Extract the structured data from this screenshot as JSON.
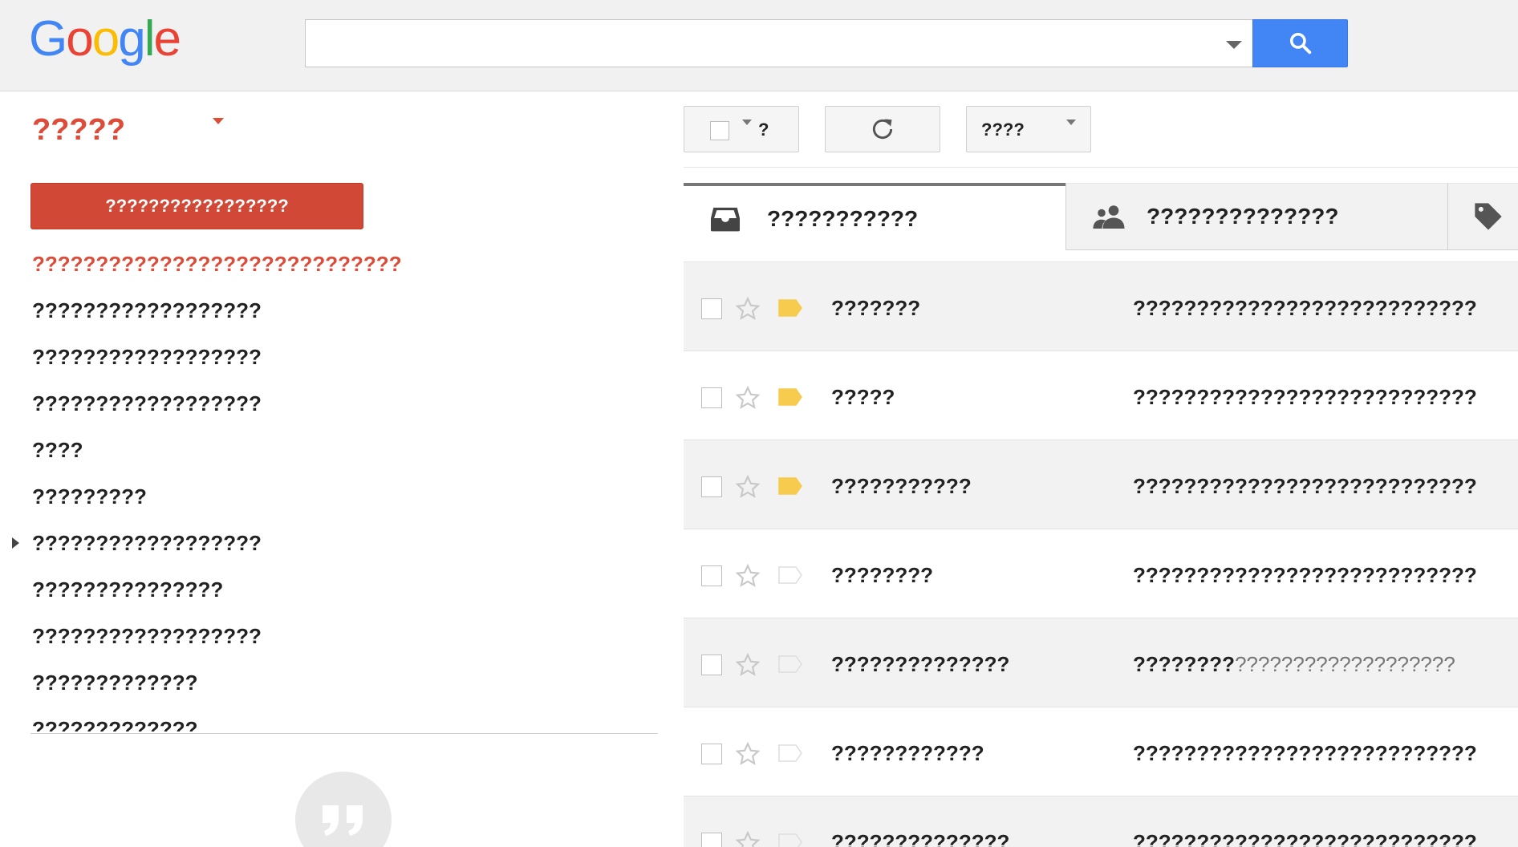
{
  "header": {
    "logo_letters": [
      {
        "char": "G",
        "color": "#4285f4"
      },
      {
        "char": "o",
        "color": "#ea4335"
      },
      {
        "char": "o",
        "color": "#fbbc05"
      },
      {
        "char": "g",
        "color": "#4285f4"
      },
      {
        "char": "l",
        "color": "#34a853"
      },
      {
        "char": "e",
        "color": "#ea4335"
      }
    ],
    "search_value": "",
    "search_icon": "search-icon",
    "search_button_color": "#4285f4"
  },
  "sidebar": {
    "app_title": "?????",
    "compose_label": "?????????????????",
    "compose_color": "#d14836",
    "accent_color": "#dd4b39",
    "items": [
      {
        "label": "?????????????????????????????",
        "active": true,
        "expandable": false
      },
      {
        "label": "??????????????????",
        "active": false,
        "expandable": false
      },
      {
        "label": "??????????????????",
        "active": false,
        "expandable": false
      },
      {
        "label": "??????????????????",
        "active": false,
        "expandable": false
      },
      {
        "label": "????",
        "active": false,
        "expandable": false
      },
      {
        "label": "?????????",
        "active": false,
        "expandable": false
      },
      {
        "label": "??????????????????",
        "active": false,
        "expandable": true
      },
      {
        "label": "???????????????",
        "active": false,
        "expandable": false
      },
      {
        "label": "??????????????????",
        "active": false,
        "expandable": false
      },
      {
        "label": "?????????????",
        "active": false,
        "expandable": false
      },
      {
        "label": "?????????????",
        "active": false,
        "expandable": false
      }
    ],
    "hangouts_icon": "quote-icon"
  },
  "toolbar": {
    "select_label": "?",
    "refresh_icon": "refresh-icon",
    "more_label": "????"
  },
  "tabs": [
    {
      "label": "???????????",
      "icon": "inbox-icon",
      "active": true
    },
    {
      "label": "??????????????",
      "icon": "people-icon",
      "active": false
    },
    {
      "label": "",
      "icon": "tag-icon",
      "active": false
    }
  ],
  "emails": [
    {
      "sender": "???????",
      "subject": "???????????????????????????",
      "snippet": "",
      "important": true,
      "unread": false
    },
    {
      "sender": "?????",
      "subject": "???????????????????????????",
      "snippet": "",
      "important": true,
      "unread": true
    },
    {
      "sender": "???????????",
      "subject": "???????????????????????????",
      "snippet": "",
      "important": true,
      "unread": false
    },
    {
      "sender": "????????",
      "subject": "???????????????????????????",
      "snippet": "",
      "important": false,
      "unread": true
    },
    {
      "sender": "??????????????",
      "subject": "????????",
      "snippet": "???????????????????",
      "important": false,
      "unread": false
    },
    {
      "sender": "????????????",
      "subject": "???????????????????????????",
      "snippet": "",
      "important": false,
      "unread": true
    },
    {
      "sender": "??????????????",
      "subject": "???????????????????????????",
      "snippet": "",
      "important": false,
      "unread": false
    }
  ],
  "colors": {
    "important_label": "#f7cb4d",
    "empty_label": "#dddddd",
    "star_outline": "#c8c8c8"
  }
}
